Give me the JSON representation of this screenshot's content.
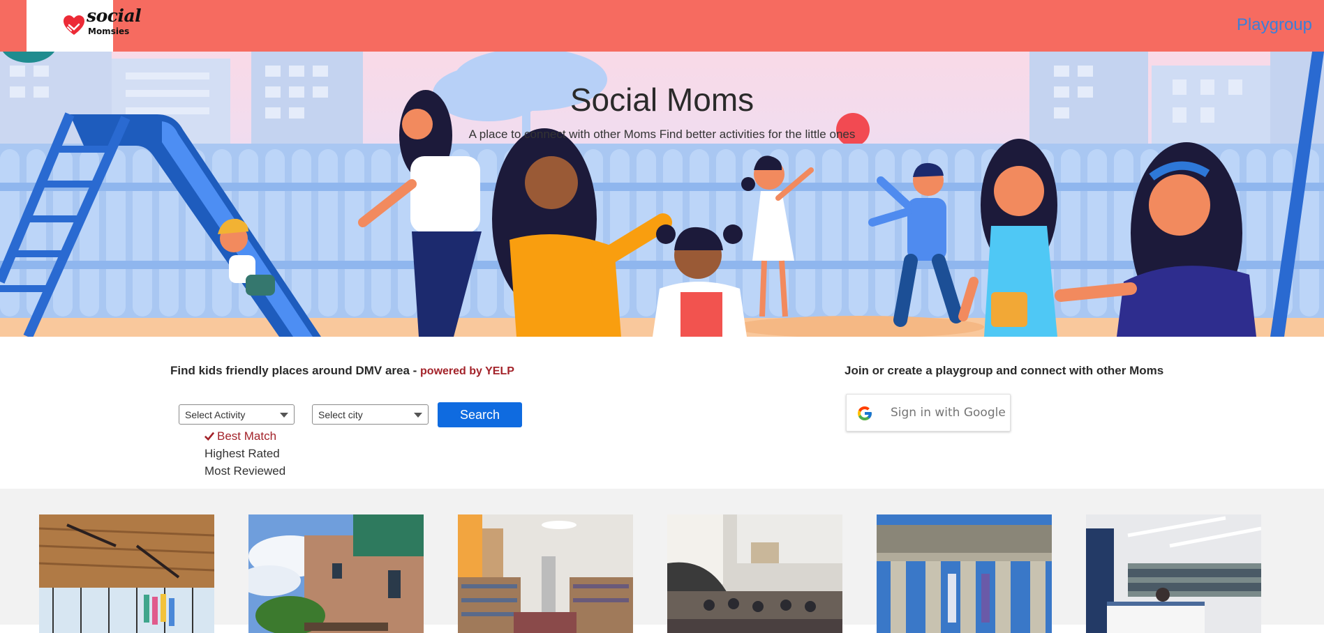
{
  "navbar": {
    "logo_text_top": "social",
    "logo_text_bottom": "Momsies",
    "link": "Playgroup"
  },
  "hero": {
    "title": "Social Moms",
    "subtitle": "A place to connect with other Moms Find better activities for the little ones"
  },
  "search": {
    "heading": "Find kids friendly places around DMV area - ",
    "powered_by": "powered by YELP",
    "activity_placeholder": "Select Activity",
    "city_placeholder": "Select city",
    "button_label": "Search",
    "sort_options": [
      {
        "label": "Best Match",
        "selected": true
      },
      {
        "label": "Highest Rated",
        "selected": false
      },
      {
        "label": "Most Reviewed",
        "selected": false
      }
    ]
  },
  "playgroup": {
    "heading": "Join or create a playgroup and connect with other Moms",
    "google_button": "Sign in with Google"
  },
  "results": {
    "cards": [
      {
        "image": "library-interior-wood-ceiling"
      },
      {
        "image": "brick-library-building-exterior"
      },
      {
        "image": "library-shelves-interior"
      },
      {
        "image": "library-reading-hall"
      },
      {
        "image": "columned-building-facade"
      },
      {
        "image": "library-stacks-desk"
      }
    ]
  },
  "colors": {
    "navbar": "#f66b60",
    "link": "#3b7fd8",
    "search_button": "#0f6be0",
    "accent_red": "#a3232a"
  }
}
